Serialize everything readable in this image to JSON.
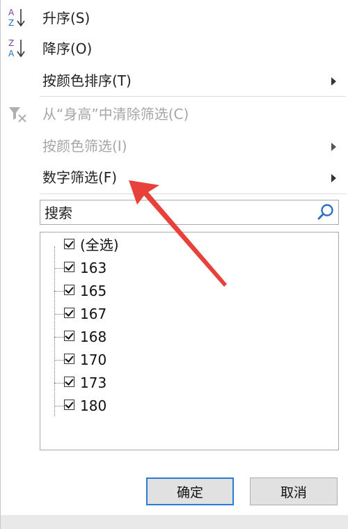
{
  "menu": {
    "sort_asc": {
      "label": "升序(S)",
      "icon_top": "A",
      "icon_bottom": "Z"
    },
    "sort_desc": {
      "label": "降序(O)",
      "icon_top": "Z",
      "icon_bottom": "A"
    },
    "sort_by_color": {
      "label": "按颜色排序(T)"
    },
    "clear_filter": {
      "label": "从“身高”中清除筛选(C)"
    },
    "filter_by_color": {
      "label": "按颜色筛选(I)"
    },
    "number_filter": {
      "label": "数字筛选(F)"
    }
  },
  "search": {
    "placeholder": "搜索"
  },
  "values": [
    {
      "label": "(全选)",
      "checked": true
    },
    {
      "label": "163",
      "checked": true
    },
    {
      "label": "165",
      "checked": true
    },
    {
      "label": "167",
      "checked": true
    },
    {
      "label": "168",
      "checked": true
    },
    {
      "label": "170",
      "checked": true
    },
    {
      "label": "173",
      "checked": true
    },
    {
      "label": "180",
      "checked": true
    }
  ],
  "buttons": {
    "ok": "确定",
    "cancel": "取消"
  },
  "colors": {
    "accent": "#2b7bd8",
    "annotation_arrow": "#e8403a",
    "sort_icon": "#7b3fa6"
  }
}
